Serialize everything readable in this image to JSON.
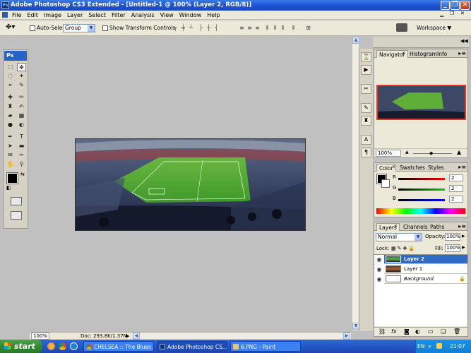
{
  "window": {
    "title": "Adobe Photoshop CS3 Extended - [Untitled-1 @ 100% (Layer 2, RGB/8)]",
    "minimize": "_",
    "restore": "❐",
    "close": "✕"
  },
  "menu": [
    "File",
    "Edit",
    "Image",
    "Layer",
    "Select",
    "Filter",
    "Analysis",
    "View",
    "Window",
    "Help"
  ],
  "options_bar": {
    "auto_select_label": "Auto-Select:",
    "auto_select_value": "Group",
    "show_transform_label": "Show Transform Controls",
    "workspace_label": "Workspace ▼"
  },
  "toolbox": {
    "logo": "Ps"
  },
  "canvas": {
    "zoom": "100%",
    "doc_info": "Doc: 293.8K/1.37M"
  },
  "navigator": {
    "tabs": [
      "Navigator",
      "Histogram",
      "Info"
    ],
    "zoom": "100%"
  },
  "color_panel": {
    "tabs": [
      "Color",
      "Swatches",
      "Styles"
    ],
    "channels": [
      {
        "label": "R",
        "value": "2",
        "color": "#ff0000"
      },
      {
        "label": "G",
        "value": "2",
        "color": "#00c000"
      },
      {
        "label": "B",
        "value": "2",
        "color": "#0000ff"
      }
    ]
  },
  "layers_panel": {
    "tabs": [
      "Layers",
      "Channels",
      "Paths"
    ],
    "blend_mode": "Normal",
    "opacity_label": "Opacity:",
    "opacity": "100%",
    "lock_label": "Lock:",
    "fill_label": "Fill:",
    "fill": "100%",
    "layers": [
      "Layer 2",
      "Layer 1",
      "Background"
    ]
  },
  "taskbar": {
    "start": "start",
    "tasks": [
      "CHELSEA :: The Blues...",
      "Adobe Photoshop CS...",
      "6.PNG - Paint"
    ],
    "lang": "EN",
    "time": "21:07"
  },
  "colors": {
    "accent": "#316ac5",
    "selection": "#316ac5",
    "pitch": "#3f9a2a"
  }
}
